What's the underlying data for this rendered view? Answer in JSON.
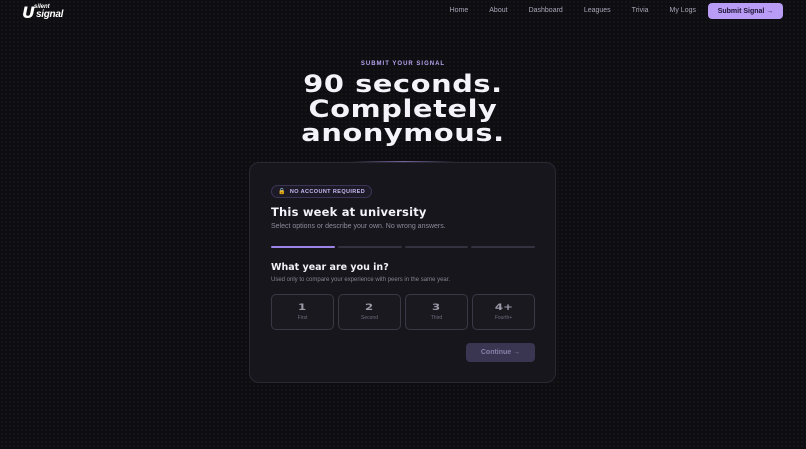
{
  "brand": {
    "mark": "U",
    "word_top": "silent",
    "word_bottom": "signal"
  },
  "nav": {
    "links": [
      "Home",
      "About",
      "Dashboard",
      "Leagues",
      "Trivia",
      "My Logs"
    ],
    "cta": "Submit Signal →"
  },
  "hero": {
    "eyebrow": "SUBMIT YOUR SIGNAL",
    "lines": [
      "90 seconds.",
      "Completely",
      "anonymous."
    ]
  },
  "card": {
    "badge": "NO ACCOUNT REQUIRED",
    "badge_icon": "lock-icon",
    "title": "This week at university",
    "subtitle": "Select options or describe your own. No wrong answers.",
    "progress": {
      "total_steps": 4,
      "current_step": 1
    },
    "question": {
      "title": "What year are you in?",
      "subtitle": "Used only to compare your experience with peers in the same year.",
      "options": [
        {
          "num": "1",
          "label": "First"
        },
        {
          "num": "2",
          "label": "Second"
        },
        {
          "num": "3",
          "label": "Third"
        },
        {
          "num": "4+",
          "label": "Fourth+"
        }
      ]
    },
    "continue": "Continue →"
  },
  "colors": {
    "accent": "#b89cf5",
    "background": "#0e0e12",
    "card": "#17161c"
  }
}
